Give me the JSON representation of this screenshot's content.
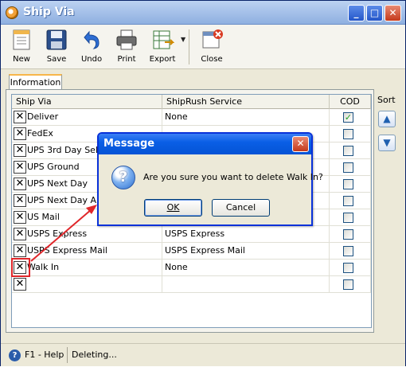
{
  "window": {
    "title": "Ship Via"
  },
  "toolbar": {
    "new_label": "New",
    "save_label": "Save",
    "undo_label": "Undo",
    "print_label": "Print",
    "export_label": "Export",
    "close_label": "Close"
  },
  "tabs": {
    "information": "Information"
  },
  "grid": {
    "headers": {
      "ship_via": "Ship Via",
      "shiprush_service": "ShipRush Service",
      "cod": "COD"
    },
    "rows": [
      {
        "ship_via": "Deliver",
        "service": "None",
        "cod": true
      },
      {
        "ship_via": "FedEx",
        "service": "",
        "cod": false
      },
      {
        "ship_via": "UPS 3rd Day Select",
        "service": "",
        "cod": false
      },
      {
        "ship_via": "UPS Ground",
        "service": "",
        "cod": false
      },
      {
        "ship_via": "UPS Next Day",
        "service": "",
        "cod": false
      },
      {
        "ship_via": "UPS Next Day Air",
        "service": "",
        "cod": false
      },
      {
        "ship_via": "US Mail",
        "service": "",
        "cod": false
      },
      {
        "ship_via": "USPS Express",
        "service": "USPS Express",
        "cod": false
      },
      {
        "ship_via": "USPS Express Mail",
        "service": "USPS Express Mail",
        "cod": false
      },
      {
        "ship_via": "Walk In",
        "service": "None",
        "cod": false
      },
      {
        "ship_via": "",
        "service": "",
        "cod": false
      }
    ]
  },
  "sort": {
    "label": "Sort"
  },
  "statusbar": {
    "help": "F1 - Help",
    "status": "Deleting..."
  },
  "dialog": {
    "title": "Message",
    "message": "Are you sure you want to delete Walk In?",
    "ok_label": "OK",
    "cancel_label": "Cancel"
  },
  "colors": {
    "annotation": "#e0262a",
    "titlebar": "#a7c2ea",
    "dialog_title": "#0453d5"
  }
}
